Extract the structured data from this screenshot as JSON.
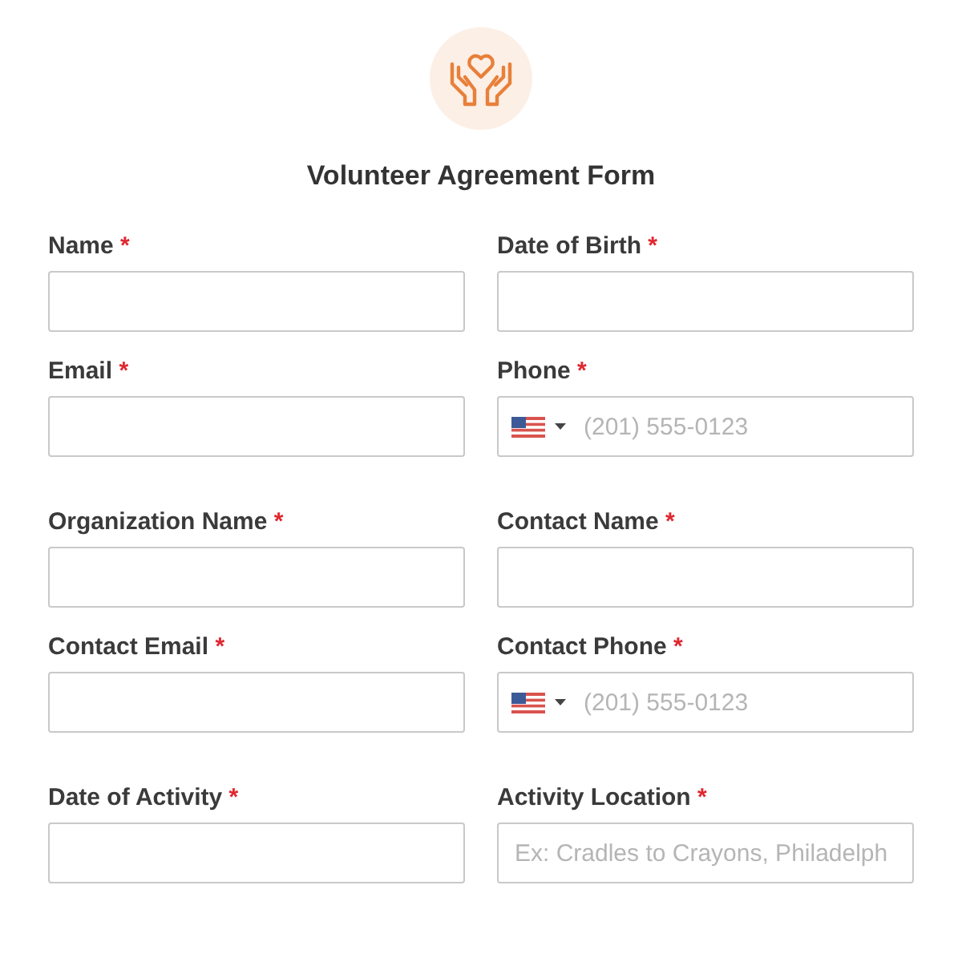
{
  "form": {
    "title": "Volunteer Agreement Form"
  },
  "sections": [
    {
      "fields": [
        {
          "label": "Name",
          "mark": "*",
          "kind": "text"
        },
        {
          "label": "Date of Birth",
          "mark": "*",
          "kind": "text"
        },
        {
          "label": "Email",
          "mark": "*",
          "kind": "text"
        },
        {
          "label": "Phone",
          "mark": "*",
          "kind": "phone",
          "placeholder": "(201) 555-0123"
        }
      ]
    },
    {
      "fields": [
        {
          "label": "Organization Name",
          "mark": "*",
          "kind": "text"
        },
        {
          "label": "Contact Name",
          "mark": "*",
          "kind": "text"
        },
        {
          "label": "Contact Email",
          "mark": "*",
          "kind": "text"
        },
        {
          "label": "Contact Phone",
          "mark": "*",
          "kind": "phone",
          "placeholder": "(201) 555-0123"
        }
      ]
    },
    {
      "fields": [
        {
          "label": "Date of Activity",
          "mark": "*",
          "kind": "text"
        },
        {
          "label": "Activity Location",
          "mark": "*",
          "kind": "text",
          "placeholder": "Ex: Cradles to Crayons, Philadelph"
        }
      ]
    }
  ]
}
